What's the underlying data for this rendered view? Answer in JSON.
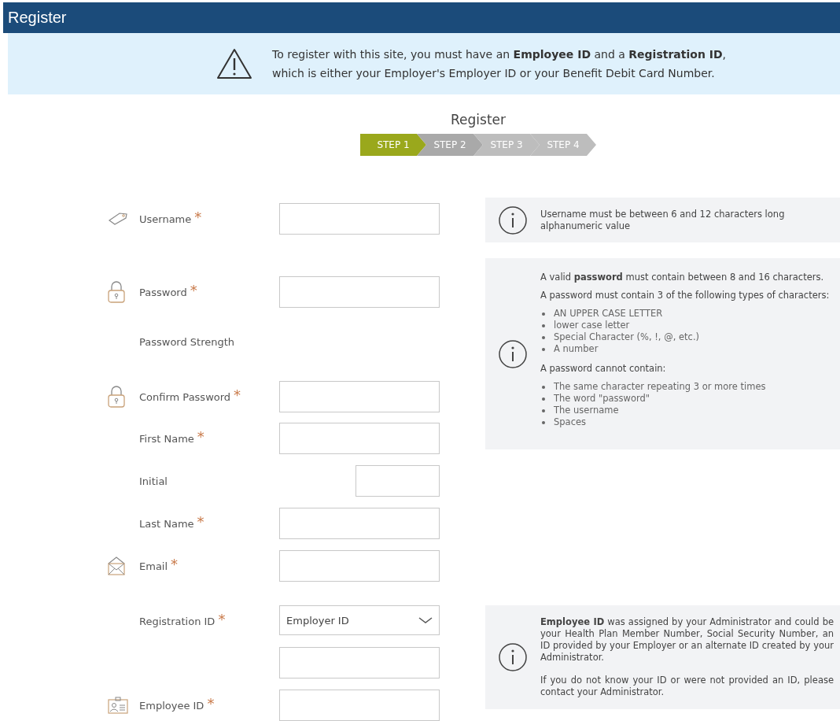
{
  "header": {
    "title": "Register"
  },
  "notice": {
    "text": "To register with this site, you must have an **Employee ID** and a **Registration ID**, which is either your Employer's Employer ID or your Benefit Debit Card Number."
  },
  "form_title": "Register",
  "steps": [
    {
      "label": "STEP 1",
      "selected": true,
      "done": false
    },
    {
      "label": "STEP 2",
      "selected": false,
      "done": true
    },
    {
      "label": "STEP 3",
      "selected": false,
      "done": false
    },
    {
      "label": "STEP 4",
      "selected": false,
      "done": false
    }
  ],
  "fields": [
    {
      "kind": "username",
      "label": "Username",
      "required": true
    },
    {
      "kind": "password",
      "label": "Password",
      "required": true
    },
    {
      "kind": "label",
      "label": "Password Strength",
      "required": false
    },
    {
      "kind": "confirm",
      "label": "Confirm Password",
      "required": true
    },
    {
      "kind": "text",
      "label": "First Name",
      "required": true
    },
    {
      "kind": "short",
      "label": "Initial",
      "required": false
    },
    {
      "kind": "text",
      "label": "Last Name",
      "required": true
    },
    {
      "kind": "email",
      "label": "Email",
      "required": true
    },
    {
      "kind": "select",
      "label": "Registration ID",
      "required": true,
      "value": "Employer ID"
    },
    {
      "kind": "blank",
      "required": false
    },
    {
      "kind": "id",
      "label": "Employee ID",
      "required": true
    }
  ],
  "required_mark": "*",
  "info_boxes": [
    {
      "paragraphs": [
        "Username must be between 6 and 12 characters long alphanumeric value"
      ]
    },
    {
      "paragraphs": [
        "A valid **password** must contain between 8 and 16 characters.",
        "A password must contain 3 of the following types of characters:"
      ],
      "list": [
        "AN UPPER CASE LETTER",
        "lower case letter",
        "Special Character (%, !, @, etc.)",
        "A number"
      ],
      "paragraphs2": [
        "A password cannot contain:"
      ],
      "list2": [
        "The same character repeating 3 or more times",
        "The word \"password\"",
        "The username",
        "Spaces"
      ]
    },
    {
      "paragraphs": [
        "**Employee ID** was assigned by your Administrator and could be your Health Plan Member Number, Social Security Number, an ID provided by your Employer or an alternate ID created by your Administrator.",
        "If you do not know your ID or were not provided an ID, please contact your Administrator."
      ]
    }
  ]
}
